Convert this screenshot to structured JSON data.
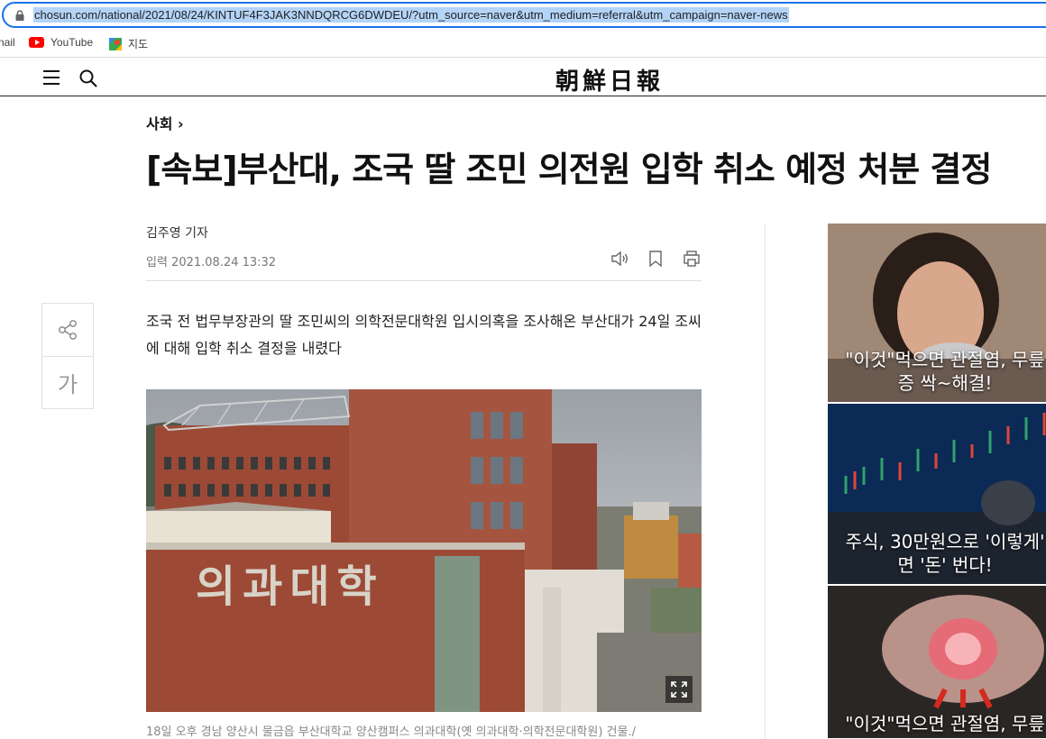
{
  "browser": {
    "url": "chosun.com/national/2021/08/24/KINTUF4F3JAK3NNDQRCG6DWDEU/?utm_source=naver&utm_medium=referral&utm_campaign=naver-news",
    "bookmarks": [
      {
        "label": "nail",
        "icon": "gmail-icon"
      },
      {
        "label": "YouTube",
        "icon": "youtube-icon"
      },
      {
        "label": "지도",
        "icon": "maps-icon"
      }
    ]
  },
  "site": {
    "logo": "朝鮮日報"
  },
  "article": {
    "section": "사회",
    "section_chevron": "›",
    "headline": "[속보]부산대, 조국 딸 조민 의전원 입학 취소 예정 처분 결정",
    "byline": "김주영 기자",
    "timestamp": "입력 2021.08.24 13:32",
    "font_size_label": "가",
    "lead": "조국 전 법무부장관의 딸 조민씨의 의학전문대학원 입시의혹을 조사해온 부산대가 24일 조씨에 대해 입학 취소 결정을 내렸다",
    "photo_sign": "의과대학",
    "caption": "18일 오후 경남 양산시 물금읍 부산대학교 양산캠퍼스 의과대학(옛 의과대학·의학전문대학원) 건물./"
  },
  "ads": [
    {
      "line1": "\"이것\"먹으면 관절염, 무릎",
      "line2": "증 싹~해결!"
    },
    {
      "line1": "주식, 30만원으로 '이렇게'",
      "line2": "면 '돈' 번다!"
    },
    {
      "line1": "\"이것\"먹으면 관절염, 무릎",
      "line2": ""
    }
  ],
  "colors": {
    "accent": "#1a73e8",
    "url_highlight": "#b4d4f7",
    "brick": "#9c4a36"
  }
}
